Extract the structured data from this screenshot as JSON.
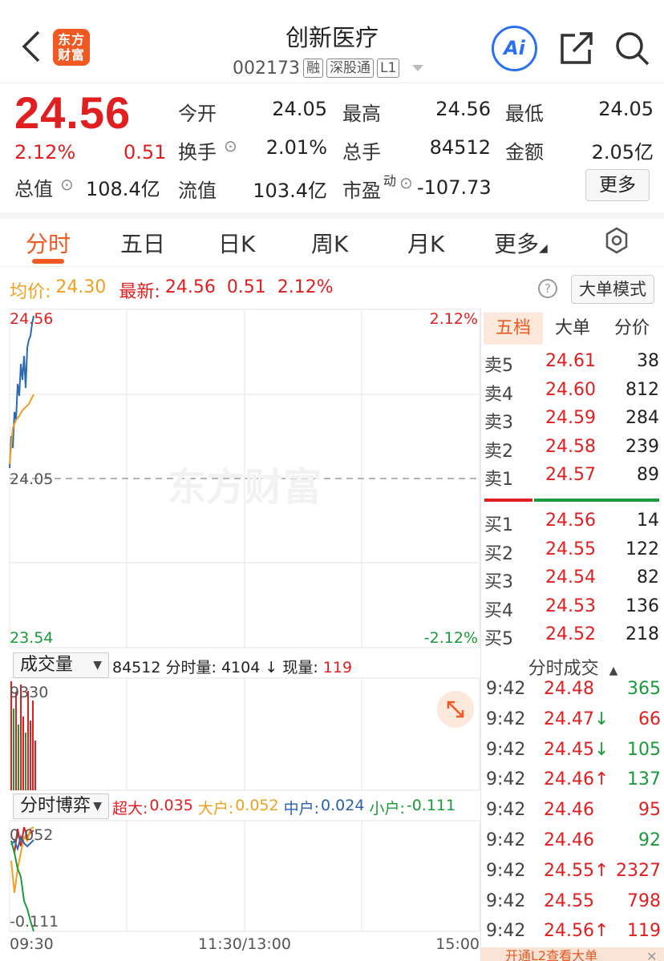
{
  "header": {
    "stock_name": "创新医疗",
    "logo_line1": "东方",
    "logo_line2": "财富",
    "code": "002173",
    "tags": [
      "融",
      "深股通",
      "L1"
    ]
  },
  "quote": {
    "price": "24.56",
    "change_pct": "2.12%",
    "change": "0.51",
    "market_value_label": "总值",
    "market_value": "108.4亿",
    "fields": [
      {
        "label": "今开",
        "value": "24.05",
        "color": "#222222"
      },
      {
        "label": "最高",
        "value": "24.56",
        "color": "#e02020"
      },
      {
        "label": "最低",
        "value": "24.05",
        "color": "#222222"
      },
      {
        "label": "换手",
        "value": "2.01%",
        "color": "#222222"
      },
      {
        "label": "总手",
        "value": "84512",
        "color": "#222222"
      },
      {
        "label": "金额",
        "value": "2.05亿",
        "color": "#222222"
      },
      {
        "label": "流值",
        "value": "103.4亿",
        "color": "#222222"
      },
      {
        "label": "市盈",
        "value": "-107.73",
        "color": "#222222"
      }
    ],
    "pe_sup": "动",
    "more_label": "更多"
  },
  "tabs": [
    "分时",
    "五日",
    "日K",
    "周K",
    "月K",
    "更多"
  ],
  "info": {
    "avg_label": "均价:",
    "avg_value": "24.30",
    "latest_label": "最新:",
    "latest_value": "24.56",
    "latest_change": "0.51",
    "latest_pct": "2.12%",
    "help": "?",
    "big_order_mode": "大单模式"
  },
  "chart": {
    "price_max": "24.56",
    "price_mid": "24.05",
    "price_min": "23.54",
    "pct_max": "2.12%",
    "pct_min": "-2.12%",
    "watermark": "东方财富",
    "time_start": "09:30",
    "time_mid": "11:30/13:00",
    "time_end": "15:00",
    "volume_max": "9330",
    "game_max": "0.052",
    "game_min": "-0.111"
  },
  "volume_panel": {
    "selector": "成交量",
    "total": "84512",
    "minute_label": "分时量:",
    "minute_value": "4104",
    "current_label": "现量:",
    "current_value": "119"
  },
  "game_panel": {
    "selector": "分时博弈",
    "super_label": "超大:",
    "super_value": "0.035",
    "large_label": "大户:",
    "large_value": "0.052",
    "mid_label": "中户:",
    "mid_value": "0.024",
    "small_label": "小户:",
    "small_value": "-0.111"
  },
  "orderbook": {
    "tabs": [
      "五档",
      "大单",
      "分价"
    ],
    "asks": [
      {
        "label": "卖5",
        "price": "24.61",
        "vol": "38"
      },
      {
        "label": "卖4",
        "price": "24.60",
        "vol": "812"
      },
      {
        "label": "卖3",
        "price": "24.59",
        "vol": "284"
      },
      {
        "label": "卖2",
        "price": "24.58",
        "vol": "239"
      },
      {
        "label": "卖1",
        "price": "24.57",
        "vol": "89"
      }
    ],
    "bids": [
      {
        "label": "买1",
        "price": "24.56",
        "vol": "14"
      },
      {
        "label": "买2",
        "price": "24.55",
        "vol": "122"
      },
      {
        "label": "买3",
        "price": "24.54",
        "vol": "82"
      },
      {
        "label": "买4",
        "price": "24.53",
        "vol": "136"
      },
      {
        "label": "买5",
        "price": "24.52",
        "vol": "218"
      }
    ]
  },
  "trades": {
    "title": "分时成交",
    "rows": [
      {
        "time": "9:42",
        "price": "24.48",
        "arrow": "",
        "vol": "365",
        "pcolor": "#e02020",
        "vcolor": "#1a9a3a",
        "acolor": ""
      },
      {
        "time": "9:42",
        "price": "24.47",
        "arrow": "↓",
        "vol": "66",
        "pcolor": "#e02020",
        "vcolor": "#e02020",
        "acolor": "#1a9a3a"
      },
      {
        "time": "9:42",
        "price": "24.45",
        "arrow": "↓",
        "vol": "105",
        "pcolor": "#e02020",
        "vcolor": "#1a9a3a",
        "acolor": "#1a9a3a"
      },
      {
        "time": "9:42",
        "price": "24.46",
        "arrow": "↑",
        "vol": "137",
        "pcolor": "#e02020",
        "vcolor": "#1a9a3a",
        "acolor": "#e02020"
      },
      {
        "time": "9:42",
        "price": "24.46",
        "arrow": "",
        "vol": "95",
        "pcolor": "#e02020",
        "vcolor": "#e02020",
        "acolor": ""
      },
      {
        "time": "9:42",
        "price": "24.46",
        "arrow": "",
        "vol": "92",
        "pcolor": "#e02020",
        "vcolor": "#1a9a3a",
        "acolor": ""
      },
      {
        "time": "9:42",
        "price": "24.55",
        "arrow": "↑",
        "vol": "2327",
        "pcolor": "#e02020",
        "vcolor": "#e02020",
        "acolor": "#e02020"
      },
      {
        "time": "9:42",
        "price": "24.55",
        "arrow": "",
        "vol": "798",
        "pcolor": "#e02020",
        "vcolor": "#e02020",
        "acolor": ""
      },
      {
        "time": "9:42",
        "price": "24.56",
        "arrow": "↑",
        "vol": "119",
        "pcolor": "#e02020",
        "vcolor": "#e02020",
        "acolor": "#e02020"
      }
    ]
  },
  "bottom_banner": "开通L2查看大单",
  "colors": {
    "accent": "#f05a22",
    "up": "#e02020",
    "down": "#1a9a3a",
    "price_line": "#2a6bb0",
    "avg_line": "#f0a020"
  }
}
